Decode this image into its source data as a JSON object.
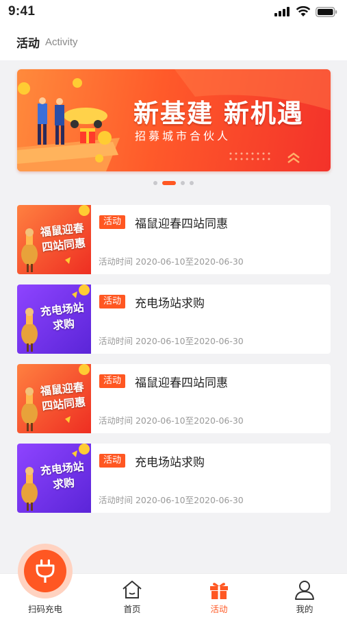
{
  "status": {
    "time": "9:41"
  },
  "header": {
    "title": "活动",
    "subtitle": "Activity"
  },
  "banner": {
    "title": "新基建 新机遇",
    "subtitle": "招募城市合伙人",
    "page_count": 4,
    "active_page": 1
  },
  "activities": [
    {
      "tag": "活动",
      "title": "福鼠迎春四站同惠",
      "time": "活动时间 2020-06-10至2020-06-30",
      "thumb_text": "福鼠迎春四站同惠",
      "thumb_color": "orange"
    },
    {
      "tag": "活动",
      "title": "充电场站求购",
      "time": "活动时间 2020-06-10至2020-06-30",
      "thumb_text": "充电场站求购",
      "thumb_color": "purple"
    },
    {
      "tag": "活动",
      "title": "福鼠迎春四站同惠",
      "time": "活动时间 2020-06-10至2020-06-30",
      "thumb_text": "福鼠迎春四站同惠",
      "thumb_color": "orange"
    },
    {
      "tag": "活动",
      "title": "充电场站求购",
      "time": "活动时间 2020-06-10至2020-06-30",
      "thumb_text": "充电场站求购",
      "thumb_color": "purple"
    }
  ],
  "tabbar": {
    "items": [
      {
        "label": "扫码充电",
        "icon": "plug-icon"
      },
      {
        "label": "首页",
        "icon": "home-icon"
      },
      {
        "label": "活动",
        "icon": "gift-icon",
        "active": true
      },
      {
        "label": "我的",
        "icon": "user-icon"
      }
    ]
  },
  "colors": {
    "accent": "#ff5722",
    "banner": "#f3322a",
    "purple": "#6a2ee8"
  }
}
